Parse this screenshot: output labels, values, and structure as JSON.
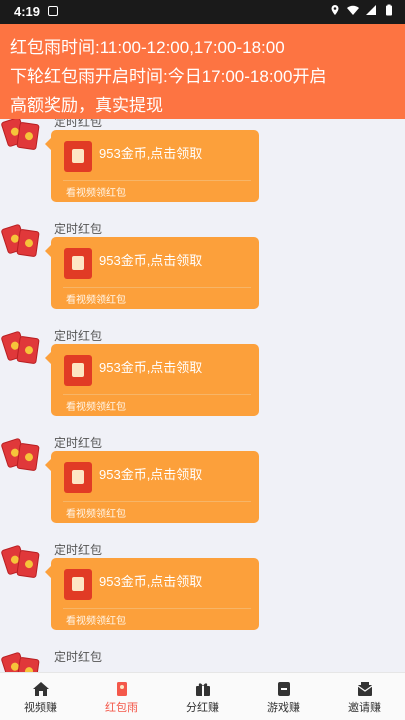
{
  "status_bar": {
    "time": "4:19"
  },
  "banner": {
    "line1": "红包雨时间:11:00-12:00,17:00-18:00",
    "line2": "下轮红包雨开启时间:今日17:00-18:00开启",
    "line3": "高额奖励，真实提现"
  },
  "messages": [
    {
      "sender": "定时红包",
      "text": "953金币,点击领取",
      "sub": "看视频领红包"
    },
    {
      "sender": "定时红包",
      "text": "953金币,点击领取",
      "sub": "看视频领红包"
    },
    {
      "sender": "定时红包",
      "text": "953金币,点击领取",
      "sub": "看视频领红包"
    },
    {
      "sender": "定时红包",
      "text": "953金币,点击领取",
      "sub": "看视频领红包"
    },
    {
      "sender": "定时红包",
      "text": "953金币,点击领取",
      "sub": "看视频领红包"
    },
    {
      "sender": "定时红包",
      "text": "",
      "sub": ""
    }
  ],
  "tabs": [
    {
      "label": "视频赚",
      "icon": "home-icon"
    },
    {
      "label": "红包雨",
      "icon": "red-envelope-icon"
    },
    {
      "label": "分红赚",
      "icon": "gift-box-icon"
    },
    {
      "label": "游戏赚",
      "icon": "game-icon"
    },
    {
      "label": "邀请赚",
      "icon": "invite-mail-icon"
    }
  ],
  "colors": {
    "banner": "#fd7442",
    "bubble": "#fca03b",
    "active_tab": "#f4584a"
  }
}
